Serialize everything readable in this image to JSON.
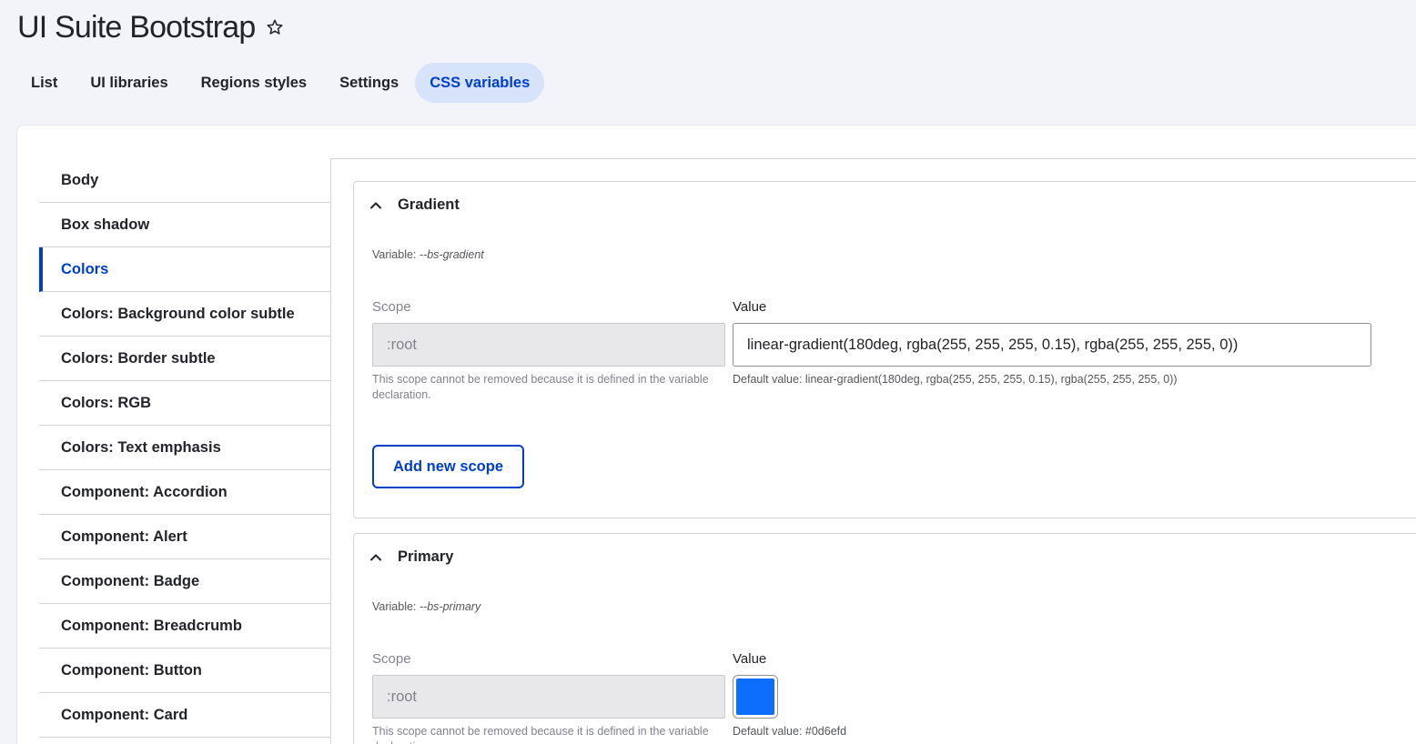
{
  "page": {
    "title": "UI Suite Bootstrap"
  },
  "tabs": [
    {
      "label": "List"
    },
    {
      "label": "UI libraries"
    },
    {
      "label": "Regions styles"
    },
    {
      "label": "Settings"
    },
    {
      "label": "CSS variables",
      "active": true
    }
  ],
  "sidebar": {
    "items": [
      {
        "label": "Body"
      },
      {
        "label": "Box shadow"
      },
      {
        "label": "Colors",
        "active": true
      },
      {
        "label": "Colors: Background color subtle"
      },
      {
        "label": "Colors: Border subtle"
      },
      {
        "label": "Colors: RGB"
      },
      {
        "label": "Colors: Text emphasis"
      },
      {
        "label": "Component: Accordion"
      },
      {
        "label": "Component: Alert"
      },
      {
        "label": "Component: Badge"
      },
      {
        "label": "Component: Breadcrumb"
      },
      {
        "label": "Component: Button"
      },
      {
        "label": "Component: Card"
      }
    ]
  },
  "variables": [
    {
      "title": "Gradient",
      "variable_prefix": "Variable: ",
      "variable_name": "--bs-gradient",
      "scope_label": "Scope",
      "scope_value": ":root",
      "scope_help": "This scope cannot be removed because it is defined in the variable declaration.",
      "value_label": "Value",
      "value": "linear-gradient(180deg, rgba(255, 255, 255, 0.15), rgba(255, 255, 255, 0))",
      "default_help": "Default value: linear-gradient(180deg, rgba(255, 255, 255, 0.15), rgba(255, 255, 255, 0))",
      "add_scope_label": "Add new scope"
    },
    {
      "title": "Primary",
      "variable_prefix": "Variable: ",
      "variable_name": "--bs-primary",
      "scope_label": "Scope",
      "scope_value": ":root",
      "scope_help": "This scope cannot be removed because it is defined in the variable declaration.",
      "value_label": "Value",
      "color": "#0d6efd",
      "default_help": "Default value: #0d6efd"
    }
  ],
  "colors": {
    "accent": "#003ecc",
    "active_tab_bg": "#d7e2fb"
  }
}
